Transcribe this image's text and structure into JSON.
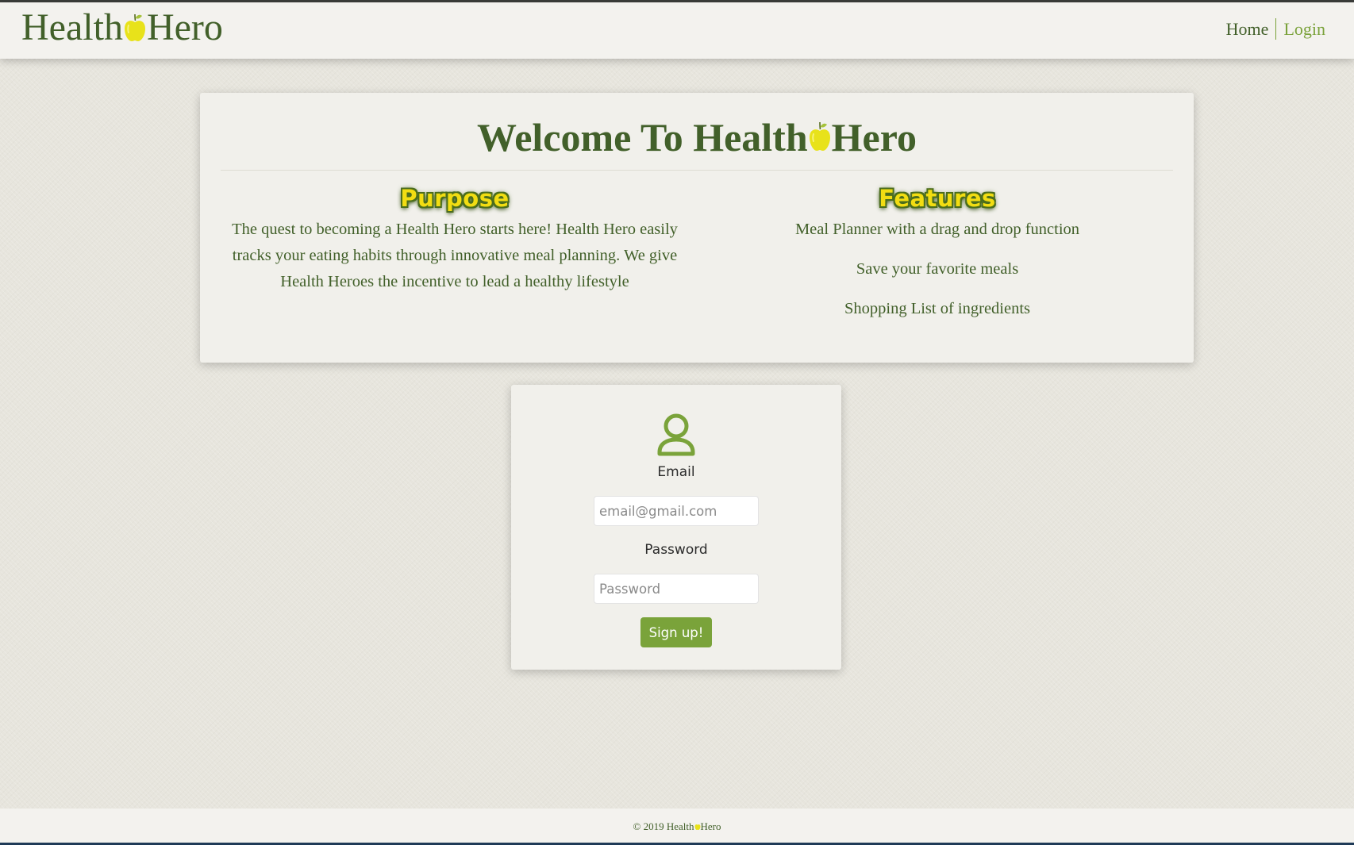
{
  "brand": {
    "part1": "Health",
    "part2": "Hero",
    "apple_icon": "apple-icon",
    "color": "#42602a",
    "apple_color": "#e8e21a"
  },
  "nav": {
    "home": "Home",
    "login": "Login"
  },
  "welcome": {
    "title_part1": "Welcome To Health",
    "title_part2": "Hero",
    "purpose": {
      "heading": "Purpose",
      "text": "The quest to becoming a Health Hero starts here! Health Hero easily tracks your eating habits through innovative meal planning. We give Health Heroes the incentive to lead a healthy lifestyle"
    },
    "features": {
      "heading": "Features",
      "items": [
        "Meal Planner with a drag and drop function",
        "Save your favorite meals",
        "Shopping List of ingredients"
      ]
    }
  },
  "login": {
    "icon": "user-icon",
    "email_label": "Email",
    "email_placeholder": "email@gmail.com",
    "password_label": "Password",
    "password_placeholder": "Password",
    "submit": "Sign up!",
    "accent": "#7aa33a"
  },
  "footer": {
    "prefix": "© 2019 Health",
    "suffix": "Hero"
  }
}
